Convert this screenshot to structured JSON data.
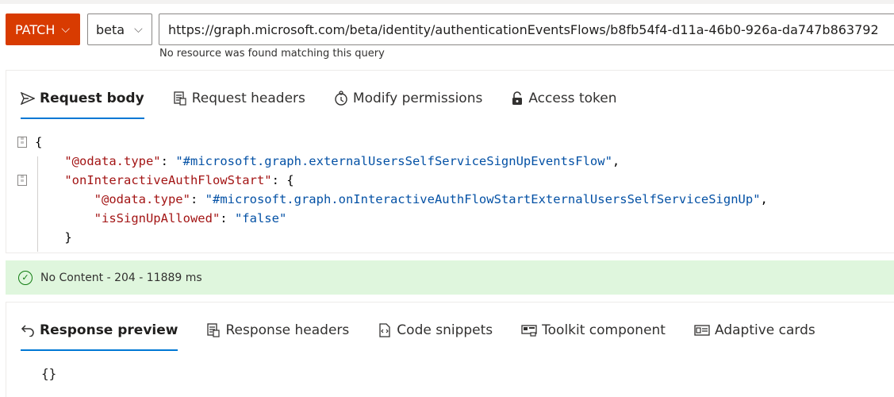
{
  "request": {
    "method": "PATCH",
    "version": "beta",
    "url": "https://graph.microsoft.com/beta/identity/authenticationEventsFlows/b8fb54f4-d11a-46b0-926a-da747b863792",
    "url_error": "No resource was found matching this query"
  },
  "request_tabs": [
    {
      "label": "Request body",
      "icon": "send-icon",
      "active": true
    },
    {
      "label": "Request headers",
      "icon": "headers-icon",
      "active": false
    },
    {
      "label": "Modify permissions",
      "icon": "permissions-icon",
      "active": false
    },
    {
      "label": "Access token",
      "icon": "lock-icon",
      "active": false
    }
  ],
  "request_body": {
    "open_brace": "{",
    "line1_key": "\"@odata.type\"",
    "line1_value": "\"#microsoft.graph.externalUsersSelfServiceSignUpEventsFlow\"",
    "line2_key": "\"onInteractiveAuthFlowStart\"",
    "line3_key": "\"@odata.type\"",
    "line3_value": "\"#microsoft.graph.onInteractiveAuthFlowStartExternalUsersSelfServiceSignUp\"",
    "line4_key": "\"isSignUpAllowed\"",
    "line4_value": "\"false\"",
    "inner_close": "}"
  },
  "status": {
    "text": "No Content - 204 - 11889 ms",
    "color": "#dff6dd"
  },
  "response_tabs": [
    {
      "label": "Response preview",
      "icon": "undo-icon",
      "active": true
    },
    {
      "label": "Response headers",
      "icon": "headers-icon",
      "active": false
    },
    {
      "label": "Code snippets",
      "icon": "code-icon",
      "active": false
    },
    {
      "label": "Toolkit component",
      "icon": "toolkit-icon",
      "active": false
    },
    {
      "label": "Adaptive cards",
      "icon": "card-icon",
      "active": false
    }
  ],
  "response_body": "{}",
  "colors": {
    "method": "#d83b01",
    "accent": "#0078d4",
    "success": "#107c10"
  }
}
